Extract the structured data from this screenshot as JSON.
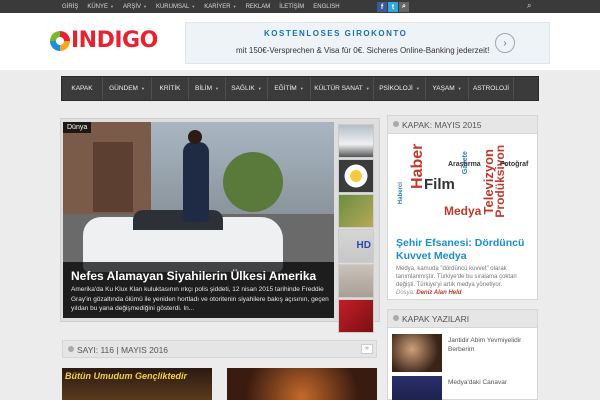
{
  "topnav": [
    {
      "label": "GİRİŞ",
      "dropdown": false
    },
    {
      "label": "KÜNYE",
      "dropdown": true
    },
    {
      "label": "ARŞİV",
      "dropdown": true
    },
    {
      "label": "KURUMSAL",
      "dropdown": true
    },
    {
      "label": "KARİYER",
      "dropdown": true
    },
    {
      "label": "REKLAM",
      "dropdown": false
    },
    {
      "label": "İLETİŞİM",
      "dropdown": false
    },
    {
      "label": "ENGLISH",
      "dropdown": false
    }
  ],
  "logo": {
    "text": "INDIGO"
  },
  "ad": {
    "title": "KOSTENLOSES GIROKONTO",
    "text": "mit 150€-Versprechen & Visa für 0€. Sicheres Online-Banking jederzeit!"
  },
  "mainnav": [
    {
      "label": "KAPAK",
      "dropdown": false,
      "w": 41
    },
    {
      "label": "GÜNDEM",
      "dropdown": true,
      "w": 49
    },
    {
      "label": "KRİTİK",
      "dropdown": false,
      "w": 37
    },
    {
      "label": "BİLİM",
      "dropdown": true,
      "w": 37
    },
    {
      "label": "SAĞLIK",
      "dropdown": true,
      "w": 42
    },
    {
      "label": "EĞİTİM",
      "dropdown": true,
      "w": 43
    },
    {
      "label": "KÜLTÜR SANAT",
      "dropdown": true,
      "w": 63
    },
    {
      "label": "PSİKOLOJİ",
      "dropdown": true,
      "w": 52
    },
    {
      "label": "YAŞAM",
      "dropdown": true,
      "w": 43
    },
    {
      "label": "ASTROLOJİ",
      "dropdown": false,
      "w": 45
    }
  ],
  "slider": {
    "tag": "Dünya",
    "title": "Nefes Alamayan Siyahilerin Ülkesi Amerika",
    "text": "Amerika'da Ku Klux Klan kuluktasının ırkçı polis şiddeti, 12 nisan 2015 tarihinde Freddie Gray'in gözaltında ölümü ile yeniden hortladı ve otoritenin siyahilere bakış açısının, geçen yıldan bu yana değişmediğini gösterdi. In..."
  },
  "section": {
    "title": "SAYI: 116 | MAYIS 2016",
    "more": "»"
  },
  "bottom_image_text": "Bütün Umudum Gençliktedir",
  "right": {
    "heading": "KAPAK: MAYIS 2015",
    "cloud": [
      {
        "t": "Haber",
        "c": "#c0392b",
        "s": 16
      },
      {
        "t": "Film",
        "c": "#333333",
        "s": 15
      },
      {
        "t": "Medya",
        "c": "#c0392b",
        "s": 12
      },
      {
        "t": "Televizyon",
        "c": "#c0392b",
        "s": 13
      },
      {
        "t": "Prodüksiyon",
        "c": "#c0392b",
        "s": 12
      },
      {
        "t": "Fotoğraf",
        "c": "#333333",
        "s": 7
      },
      {
        "t": "Gazete",
        "c": "#2c7fb8",
        "s": 7
      },
      {
        "t": "Araştırma",
        "c": "#333333",
        "s": 7
      },
      {
        "t": "Haberci",
        "c": "#2c7fb8",
        "s": 6
      }
    ],
    "title": "Şehir Efsanesi: Dördüncü Kuvvet Medya",
    "text": "Medya, kamuda \"dördüncü kuvvet\" olarak tanımlanmıştır. Türkiye'de bu sıralama çoktan değişti. Türkiye'yi artık medya yönetiyor.",
    "author_label": "Dosya:",
    "author": "Deniz Alan Held"
  },
  "right2": {
    "heading": "KAPAK YAZILARI",
    "items": [
      {
        "title": "Jantidir Abim Yevmiyelidir Berberim"
      },
      {
        "title": "Medya'daki Canavar"
      }
    ]
  }
}
